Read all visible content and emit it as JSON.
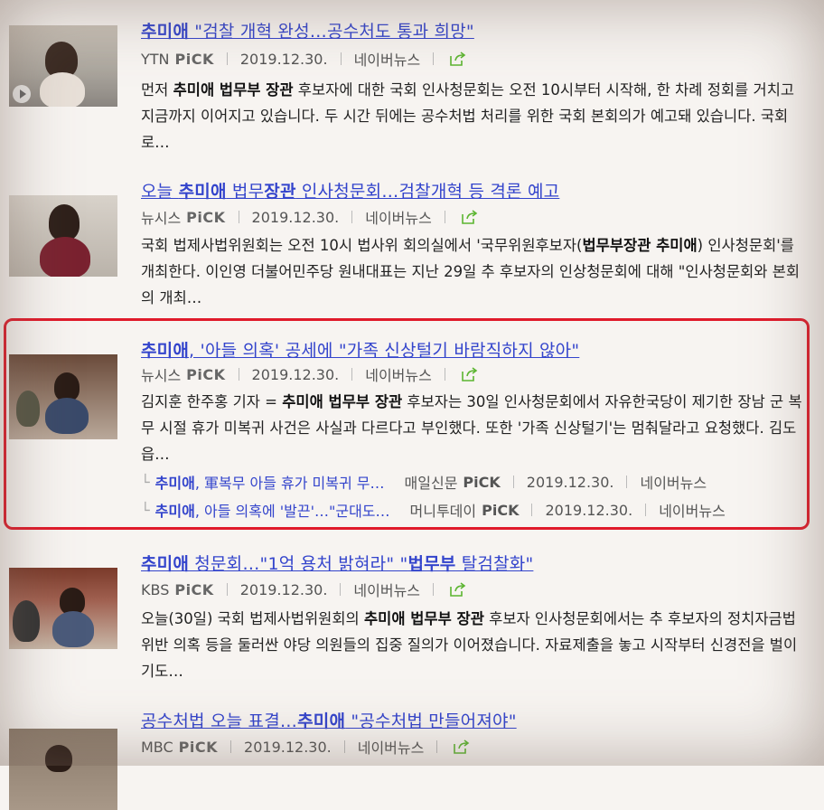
{
  "results": [
    {
      "title_pre": "",
      "title_bold1": "추미애",
      "title_mid": " \"검찰 개혁 완성…공수처도 통과 희망\"",
      "title_bold2": "",
      "title_post": "",
      "source": "YTN",
      "pick": "PiCK",
      "date": "2019.12.30.",
      "portal": "네이버뉴스",
      "desc_pre": "먼저 ",
      "desc_bold": "추미애 법무부 장관",
      "desc_post": " 후보자에 대한 국회 인사청문회는 오전 10시부터 시작해, 한 차례 정회를 거치고 지금까지 이어지고 있습니다. 두 시간 뒤에는 공수처법 처리를 위한 국회 본회의가 예고돼 있습니다. 국회로…"
    },
    {
      "title_pre": "오늘 ",
      "title_bold1": "추미애",
      "title_mid": " 법무",
      "title_bold2": "장관",
      "title_post": " 인사청문회…검찰개혁 등 격론 예고",
      "source": "뉴시스",
      "pick": "PiCK",
      "date": "2019.12.30.",
      "portal": "네이버뉴스",
      "desc_pre": "국회 법제사법위원회는 오전 10시 법사위 회의실에서 '국무위원후보자(",
      "desc_bold": "법무부장관 추미애",
      "desc_post": ") 인사청문회'를 개최한다. 이인영 더불어민주당 원내대표는 지난 29일 추 후보자의 인상청문회에 대해 \"인사청문회와 본회의 개최…"
    },
    {
      "title_pre": "",
      "title_bold1": "추미애",
      "title_mid": ", '아들 의혹' 공세에 \"가족 신상털기 바람직하지 않아\"",
      "title_bold2": "",
      "title_post": "",
      "source": "뉴시스",
      "pick": "PiCK",
      "date": "2019.12.30.",
      "portal": "네이버뉴스",
      "desc_pre": "김지훈 한주홍 기자 = ",
      "desc_bold": "추미애 법무부 장관",
      "desc_post": " 후보자는 30일 인사청문회에서 자유한국당이 제기한 장남 군 복무 시절 휴가 미복귀 사건은 사실과 다르다고 부인했다. 또한 '가족 신상털기'는 멈춰달라고 요청했다. 김도읍…",
      "related": [
        {
          "bold": "추미애",
          "text": ", 軍복무 아들 휴가 미복귀 무…",
          "source": "매일신문",
          "pick": "PiCK",
          "date": "2019.12.30.",
          "portal": "네이버뉴스"
        },
        {
          "bold": "추미애",
          "text": ", 아들 의혹에 '발끈'…\"군대도…",
          "source": "머니투데이",
          "pick": "PiCK",
          "date": "2019.12.30.",
          "portal": "네이버뉴스"
        }
      ]
    },
    {
      "title_pre": "",
      "title_bold1": "추미애",
      "title_mid": " 청문회…\"1억 용처 밝혀라\" \"",
      "title_bold2": "법무부",
      "title_post": " 탈검찰화\"",
      "source": "KBS",
      "pick": "PiCK",
      "date": "2019.12.30.",
      "portal": "네이버뉴스",
      "desc_pre": "오늘(30일) 국회 법제사법위원회의 ",
      "desc_bold": "추미애 법무부 장관",
      "desc_post": " 후보자 인사청문회에서는 추 후보자의 정치자금법 위반 의혹 등을 둘러싼 야당 의원들의 집중 질의가 이어졌습니다. 자료제출을 놓고 시작부터 신경전을 벌이기도…"
    },
    {
      "title_pre": "공수처법 오늘 표결…",
      "title_bold1": "추미애",
      "title_mid": " \"공수처법 만들어져야\"",
      "title_bold2": "",
      "title_post": "",
      "source": "MBC",
      "pick": "PiCK",
      "date": "2019.12.30.",
      "portal": "네이버뉴스"
    }
  ],
  "colors": {
    "link": "#3344cc",
    "highlight": "#e01a2a",
    "share": "#5cb531"
  }
}
